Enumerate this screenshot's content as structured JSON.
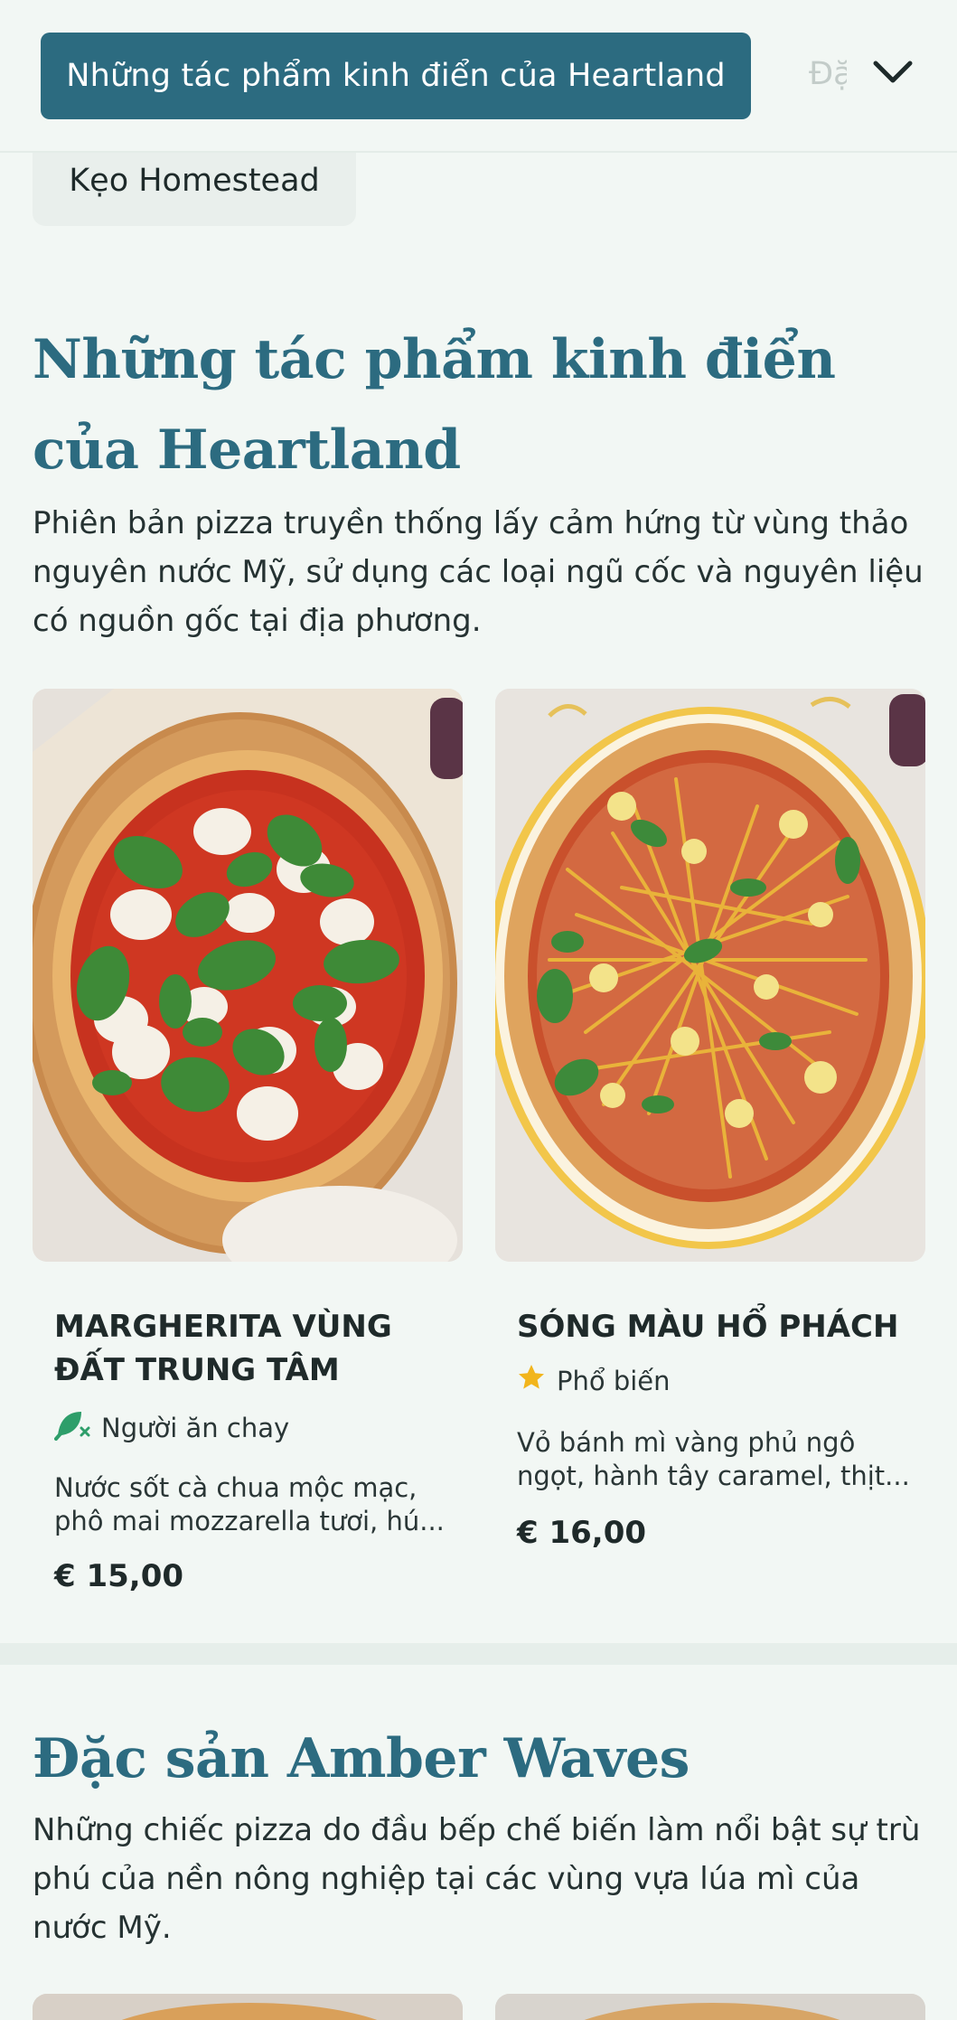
{
  "category_bar": {
    "active": "Những tác phẩm kinh điển của Heartland",
    "next_partial": "Đặc sản Amber Waves",
    "expand_icon": "chevron-down-icon"
  },
  "chip": {
    "label": "Kẹo Homestead"
  },
  "section_heartland": {
    "title": "Những tác phẩm kinh điển của Heartland",
    "description": "Phiên bản pizza truyền thống lấy cảm hứng từ vùng thảo nguyên nước Mỹ, sử dụng các loại ngũ cốc và nguyên liệu có nguồn gốc tại địa phương.",
    "items": [
      {
        "name": "MARGHERITA VÙNG ĐẤT TRUNG TÂM",
        "tag_icon": "leaf-vegetarian-icon",
        "tag": "Người ăn chay",
        "description": "Nước sốt cà chua mộc mạc, phô mai mozzarella tươi, hú...",
        "price": "€ 15,00"
      },
      {
        "name": "SÓNG MÀU HỔ PHÁCH",
        "tag_icon": "star-icon",
        "tag": "Phổ biến",
        "description": "Vỏ bánh mì vàng phủ ngô ngọt, hành tây caramel, thịt...",
        "price": "€ 16,00"
      }
    ]
  },
  "section_amber": {
    "title": "Đặc sản Amber Waves",
    "description": "Những chiếc pizza do đầu bếp chế biến làm nổi bật sự trù phú của nền nông nghiệp tại các vùng vựa lúa mì của nước Mỹ."
  },
  "colors": {
    "accent": "#2c6b80",
    "background": "#f2f7f4",
    "vegetarian_green": "#2e9e6a",
    "star_yellow": "#f2b51c"
  }
}
